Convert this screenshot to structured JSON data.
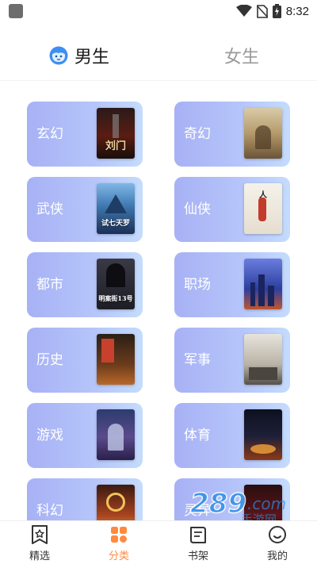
{
  "status_bar": {
    "time": "8:32"
  },
  "gender_tabs": {
    "male": "男生",
    "female": "女生"
  },
  "categories": [
    {
      "label": "玄幻",
      "cover_title": "刘门"
    },
    {
      "label": "奇幻",
      "cover_title": ""
    },
    {
      "label": "武侠",
      "cover_title": "试七天罗"
    },
    {
      "label": "仙侠",
      "cover_title": "人"
    },
    {
      "label": "都市",
      "cover_title": "明案街13号"
    },
    {
      "label": "职场",
      "cover_title": ""
    },
    {
      "label": "历史",
      "cover_title": ""
    },
    {
      "label": "军事",
      "cover_title": ""
    },
    {
      "label": "游戏",
      "cover_title": ""
    },
    {
      "label": "体育",
      "cover_title": ""
    },
    {
      "label": "科幻",
      "cover_title": ""
    },
    {
      "label": "灵异",
      "cover_title": ""
    }
  ],
  "bottom_nav": [
    {
      "label": "精选",
      "icon": "star-bookmark-icon",
      "active": false
    },
    {
      "label": "分类",
      "icon": "category-grid-icon",
      "active": true
    },
    {
      "label": "书架",
      "icon": "bookshelf-icon",
      "active": false
    },
    {
      "label": "我的",
      "icon": "profile-icon",
      "active": false
    }
  ],
  "colors": {
    "accent": "#ff8a3d",
    "card_gradient_start": "#a7b1f5",
    "card_gradient_end": "#c4dcfd"
  }
}
